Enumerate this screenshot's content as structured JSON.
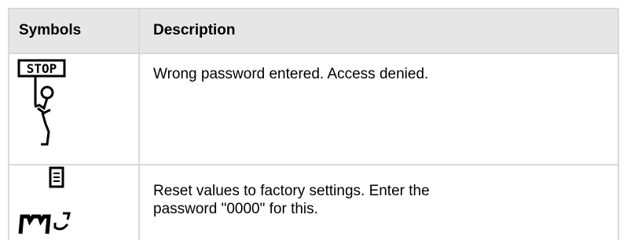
{
  "table": {
    "headers": {
      "symbols": "Symbols",
      "description": "Description"
    },
    "rows": [
      {
        "icon": "stop-sign-figure-icon",
        "icon_label": "STOP",
        "description": "Wrong password entered. Access denied."
      },
      {
        "icon": "factory-reset-icon",
        "description": "Reset values to factory settings. Enter the password \"0000\" for this."
      }
    ]
  },
  "colors": {
    "header_background": "#e6e6e6",
    "grid_line": "#d9d9d9",
    "text": "#000000"
  }
}
